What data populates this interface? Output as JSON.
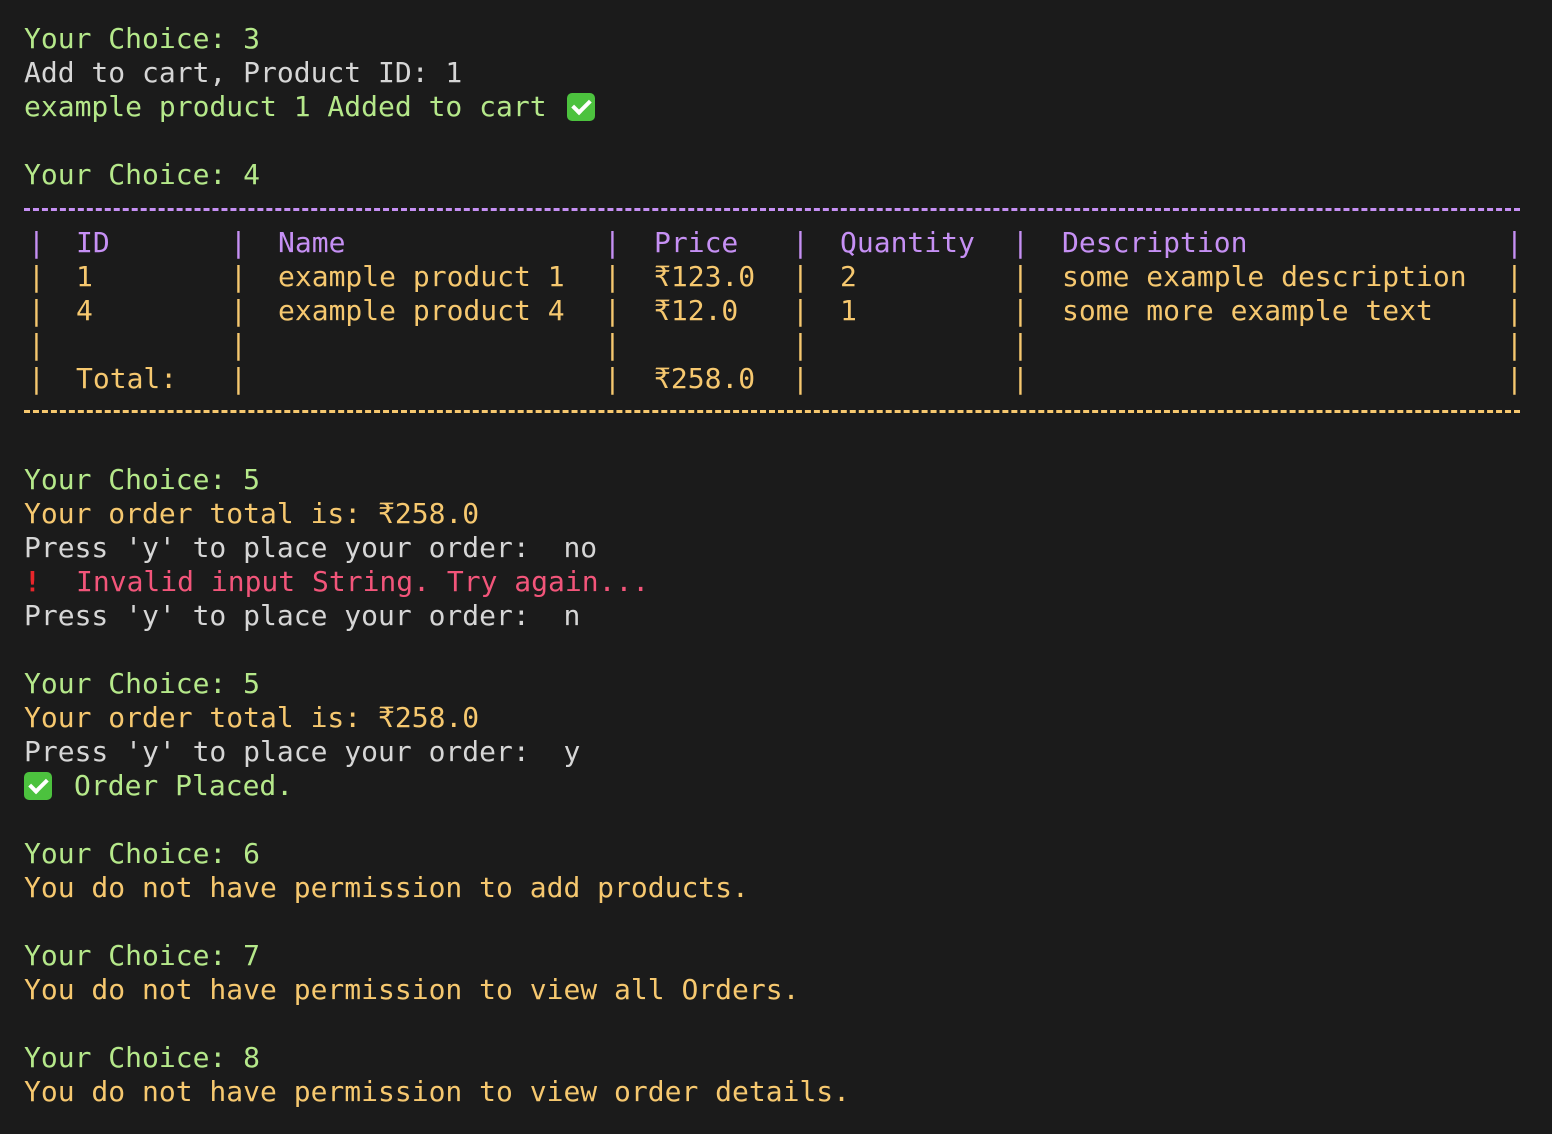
{
  "colors": {
    "background": "#1b1b1b",
    "prompt_green": "#b5e88a",
    "plain_text": "#d6d6d6",
    "warning_orange": "#f6c86f",
    "error_red": "#f2557a",
    "table_header_purple": "#c690f4",
    "success_check": "#4cc23e"
  },
  "session": {
    "b1": {
      "choice": "Your Choice: 3",
      "add_line": "Add to cart, Product ID: 1",
      "added_line": "example product 1 Added to cart",
      "added_icon": "check-mark-icon"
    },
    "b2": {
      "choice": "Your Choice: 4"
    },
    "cart_table": {
      "headers": [
        "ID",
        "Name",
        "Price",
        "Quantity",
        "Description"
      ],
      "rows": [
        {
          "id": "1",
          "name": "example product 1",
          "price": "₹123.0",
          "quantity": "2",
          "description": "some example description"
        },
        {
          "id": "4",
          "name": "example product 4",
          "price": "₹12.0",
          "quantity": "1",
          "description": "some more example text"
        }
      ],
      "total_label": "Total:",
      "total_value": "₹258.0"
    },
    "b3": {
      "choice": "Your Choice: 5",
      "order_total": "Your order total is: ₹258.0",
      "prompt1": "Press 'y' to place your order:  no",
      "error_icon": "exclamation-icon",
      "error": "Invalid input String. Try again...",
      "prompt2": "Press 'y' to place your order:  n"
    },
    "b4": {
      "choice": "Your Choice: 5",
      "order_total": "Your order total is: ₹258.0",
      "prompt": "Press 'y' to place your order:  y",
      "placed_icon": "check-mark-icon",
      "placed": "Order Placed."
    },
    "b5": {
      "choice": "Your Choice: 6",
      "message": "You do not have permission to add products."
    },
    "b6": {
      "choice": "Your Choice: 7",
      "message": "You do not have permission to view all Orders."
    },
    "b7": {
      "choice": "Your Choice: 8",
      "message": "You do not have permission to view order details."
    }
  }
}
